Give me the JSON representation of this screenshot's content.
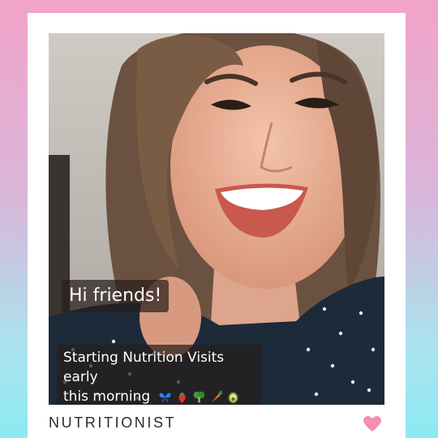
{
  "post": {
    "caption_greeting": "Hi friends!",
    "caption_line1": "Starting Nutrition Visits early",
    "caption_line2": "this morning",
    "emojis": [
      "butterfly-icon",
      "strawberry-icon",
      "broccoli-icon",
      "carrot-icon",
      "avocado-icon"
    ],
    "label": "NUTRITIONIST"
  },
  "colors": {
    "gradient_top": "#f2a3c9",
    "gradient_bottom": "#8ee9f3",
    "heart": "#f48fb1",
    "label_text": "#2e2a2a"
  }
}
